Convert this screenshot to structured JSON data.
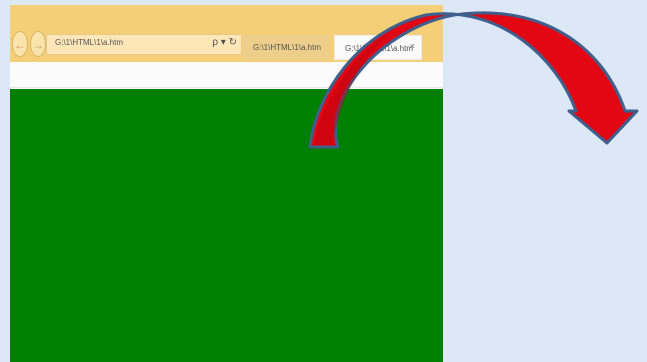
{
  "browser": {
    "address_url": "G:\\1\\HTML\\1\\a.htm",
    "search_refresh_icons": "ρ ▾ ↻",
    "tabs": [
      {
        "label": "G:\\1\\HTML\\1\\a.htm",
        "active": false
      },
      {
        "label": "G:\\1\\HTML\\1\\a.htm",
        "active": true,
        "close": "×"
      }
    ],
    "nav_icons": {
      "back": "←",
      "forward": "→"
    }
  },
  "content": {
    "background_color": "#008000"
  },
  "arrow": {
    "color": "#e30613",
    "outline_color": "#3f5f8c",
    "icon": "curved-arrow-icon"
  }
}
